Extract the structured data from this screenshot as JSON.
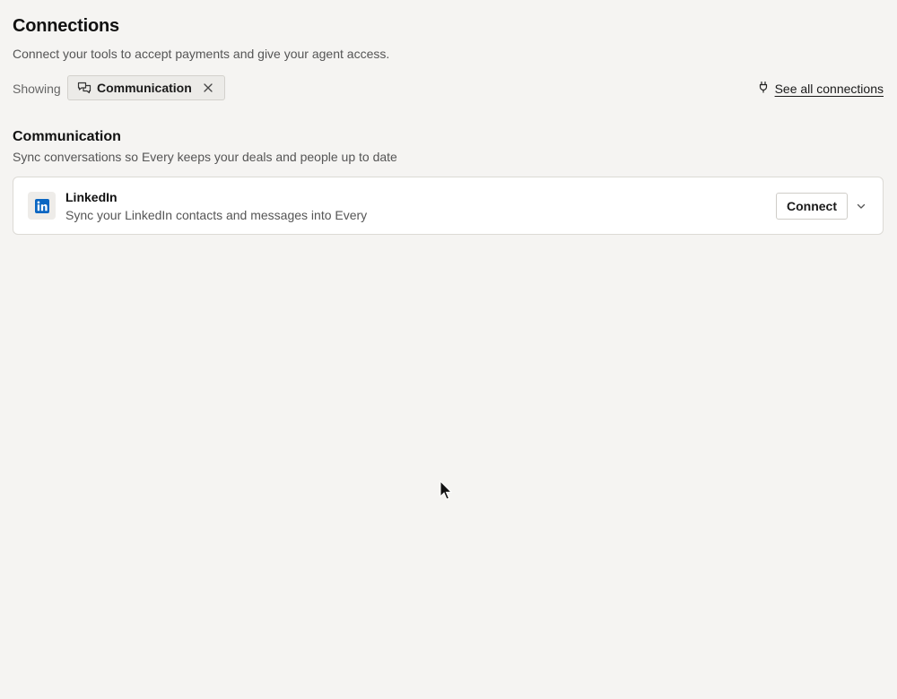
{
  "header": {
    "title": "Connections",
    "subtitle": "Connect your tools to accept payments and give your agent access."
  },
  "filter": {
    "showing_label": "Showing",
    "chip_label": "Communication",
    "chip_icon": "chat-bubbles-icon",
    "remove_icon": "close-icon",
    "see_all_label": "See all connections",
    "see_all_icon": "plug-icon"
  },
  "section": {
    "title": "Communication",
    "subtitle": "Sync conversations so Every keeps your deals and people up to date",
    "integrations": [
      {
        "name": "LinkedIn",
        "description": "Sync your LinkedIn contacts and messages into Every",
        "logo_icon": "linkedin-icon",
        "action_label": "Connect",
        "expand_icon": "chevron-down-icon"
      }
    ]
  },
  "colors": {
    "background": "#f5f4f2",
    "linkedin_brand": "#0a66c2",
    "card_border": "#dcdad5"
  }
}
